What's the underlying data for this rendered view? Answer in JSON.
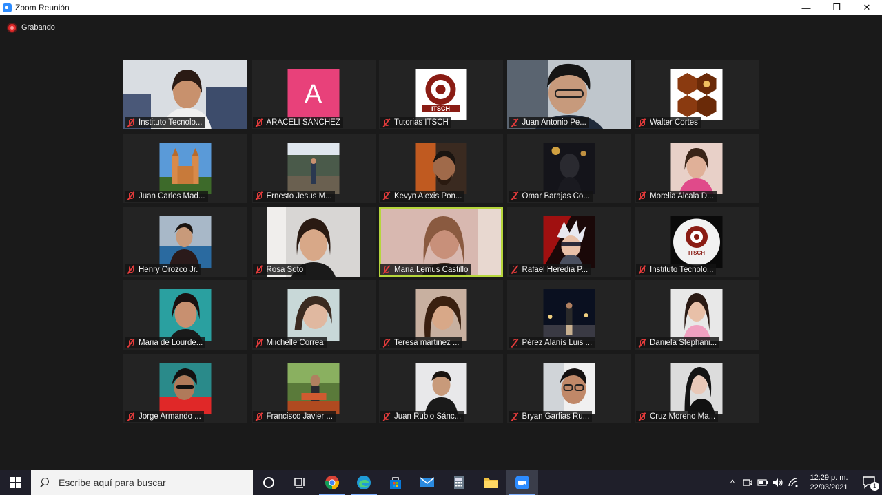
{
  "window": {
    "title": "Zoom Reunión",
    "minimize": "—",
    "maximize": "❐",
    "close": "✕"
  },
  "recording": {
    "label": "Grabando"
  },
  "participants": [
    {
      "name": "Instituto Tecnolo...",
      "thumb": "video-woman",
      "active": false
    },
    {
      "name": "ARACELI SÁNCHEZ",
      "thumb": "initial",
      "initial": "A",
      "color": "#e8417a",
      "active": false
    },
    {
      "name": "Tutorias  ITSCH",
      "thumb": "itsch-logo",
      "active": false
    },
    {
      "name": "Juan Antonio Pe...",
      "thumb": "video-man",
      "active": false
    },
    {
      "name": "Walter Cortes",
      "thumb": "paw-logo",
      "active": false
    },
    {
      "name": "Juan Carlos Mad...",
      "thumb": "cathedral",
      "active": false
    },
    {
      "name": "Ernesto Jesus M...",
      "thumb": "outdoor",
      "active": false
    },
    {
      "name": "Kevyn Alexis Pon...",
      "thumb": "portrait-dark",
      "active": false
    },
    {
      "name": "Omar Barajas Co...",
      "thumb": "portrait-night",
      "active": false
    },
    {
      "name": "Morelia Alcala D...",
      "thumb": "portrait-pink",
      "active": false
    },
    {
      "name": "Henry Orozco Jr.",
      "thumb": "portrait-hall",
      "active": false
    },
    {
      "name": "Rosa Soto",
      "thumb": "video-woman2",
      "active": false
    },
    {
      "name": "Maria Lemus Castillo",
      "thumb": "video-speaker",
      "active": true
    },
    {
      "name": "Rafael Heredia P...",
      "thumb": "anime",
      "active": false
    },
    {
      "name": "Instituto Tecnolo...",
      "thumb": "itsch-round",
      "active": false
    },
    {
      "name": "Maria de Lourde...",
      "thumb": "portrait-teal",
      "active": false
    },
    {
      "name": "Miichelle Correa",
      "thumb": "portrait-light",
      "active": false
    },
    {
      "name": "Teresa martinez ...",
      "thumb": "portrait-warm",
      "active": false
    },
    {
      "name": "Pérez Alanís Luis ...",
      "thumb": "night-street",
      "active": false
    },
    {
      "name": "Daniela Stephani...",
      "thumb": "portrait-pinktop",
      "active": false
    },
    {
      "name": "Jorge Armando ...",
      "thumb": "portrait-red",
      "active": false
    },
    {
      "name": "Francisco Javier ...",
      "thumb": "outdoor-tree",
      "active": false
    },
    {
      "name": "Juan Rubio Sánc...",
      "thumb": "portrait-white",
      "active": false
    },
    {
      "name": "Bryan Garfias Ru...",
      "thumb": "portrait-glasses",
      "active": false
    },
    {
      "name": "Cruz Moreno Ma...",
      "thumb": "portrait-bw",
      "active": false
    }
  ],
  "taskbar": {
    "search_placeholder": "Escribe aquí para buscar",
    "apps": [
      "task-view",
      "cortana",
      "chrome",
      "edge",
      "store",
      "mail",
      "calculator",
      "explorer",
      "zoom"
    ],
    "time": "12:29 p. m.",
    "date": "22/03/2021",
    "notifications": "1"
  }
}
